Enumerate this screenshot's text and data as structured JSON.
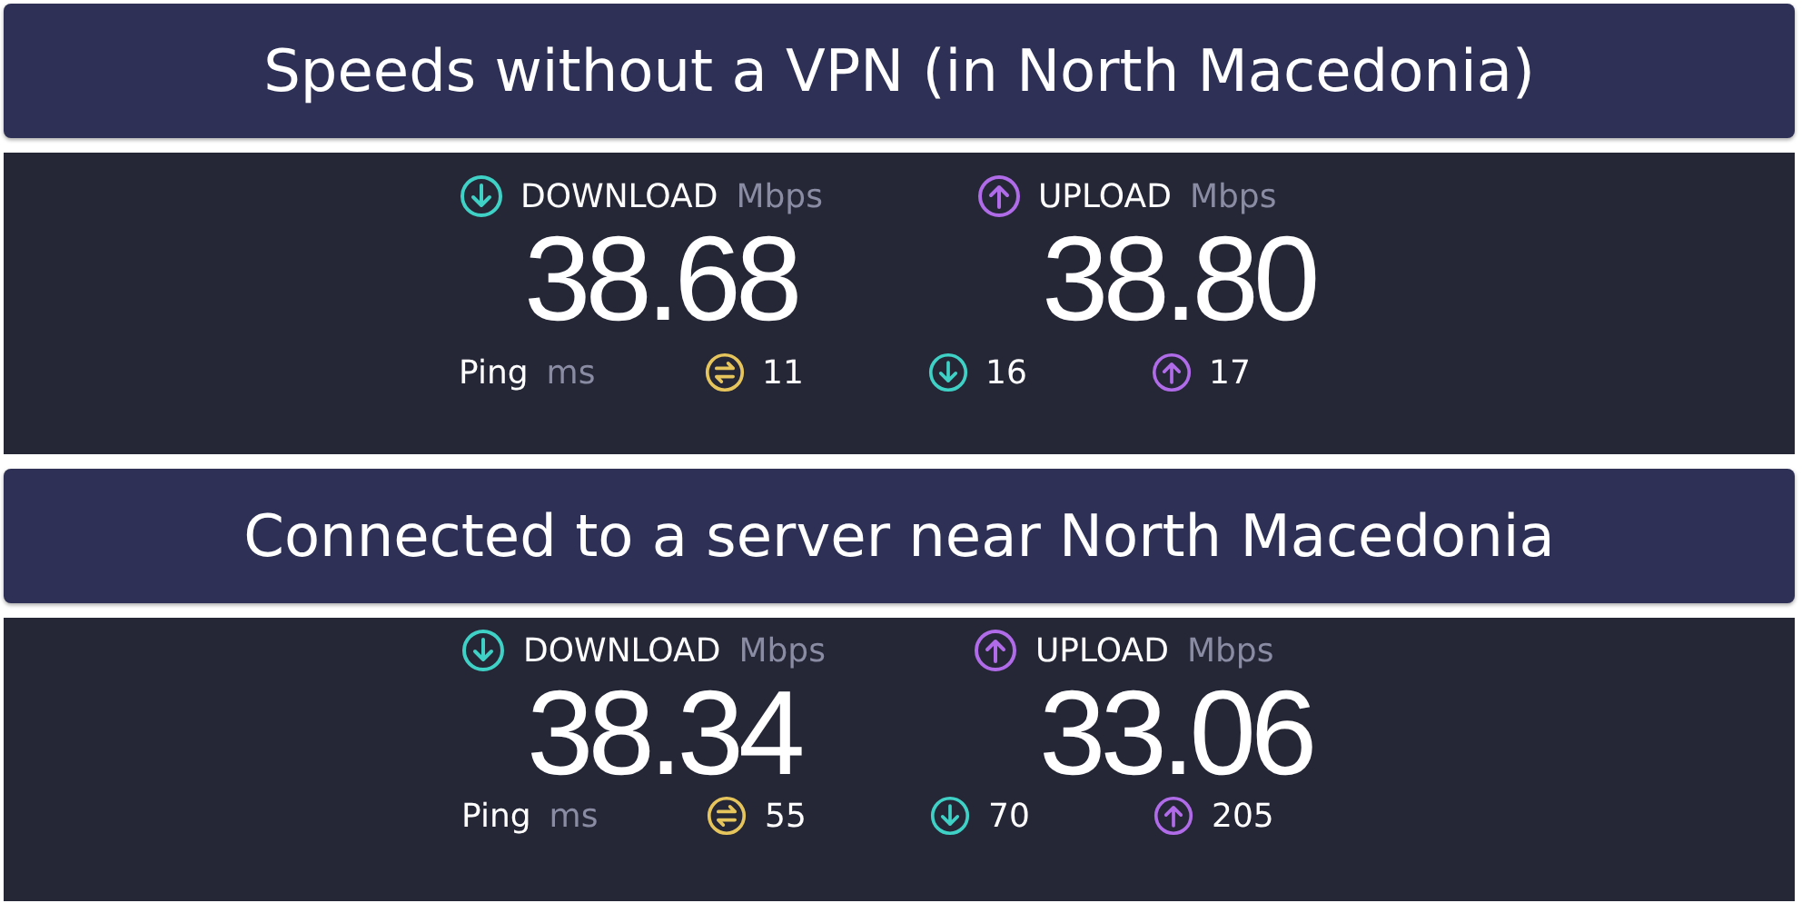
{
  "sections": [
    {
      "title": "Speeds without a VPN (in North Macedonia)",
      "download": {
        "label": "DOWNLOAD",
        "unit": "Mbps",
        "value": "38.68"
      },
      "upload": {
        "label": "UPLOAD",
        "unit": "Mbps",
        "value": "38.80"
      },
      "ping": {
        "label": "Ping",
        "unit": "ms",
        "idle": "11",
        "download": "16",
        "upload": "17"
      }
    },
    {
      "title": "Connected to a server near North Macedonia",
      "download": {
        "label": "DOWNLOAD",
        "unit": "Mbps",
        "value": "38.34"
      },
      "upload": {
        "label": "UPLOAD",
        "unit": "Mbps",
        "value": "33.06"
      },
      "ping": {
        "label": "Ping",
        "unit": "ms",
        "idle": "55",
        "download": "70",
        "upload": "205"
      }
    }
  ]
}
